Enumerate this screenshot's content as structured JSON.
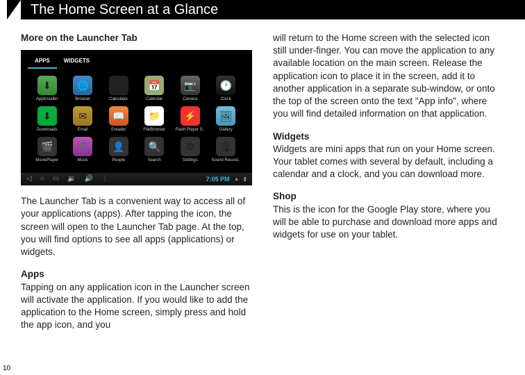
{
  "title": "The Home Screen at a Glance",
  "left": {
    "heading": "More on the Launcher Tab",
    "tabs": {
      "apps": "APPS",
      "widgets": "WIDGETS"
    },
    "apps": [
      {
        "label": "AppInstaller",
        "cls": "ic-install",
        "g": "⬇"
      },
      {
        "label": "Browser",
        "cls": "ic-browser",
        "g": "🌐"
      },
      {
        "label": "Calculator",
        "cls": "ic-calc",
        "g": "🖩"
      },
      {
        "label": "Calendar",
        "cls": "ic-cal",
        "g": "📅"
      },
      {
        "label": "Camera",
        "cls": "ic-cam",
        "g": "📷"
      },
      {
        "label": "Clock",
        "cls": "ic-clock",
        "g": "🕐"
      },
      {
        "label": "Downloads",
        "cls": "ic-down",
        "g": "⬇"
      },
      {
        "label": "Email",
        "cls": "ic-email",
        "g": "✉"
      },
      {
        "label": "Ereader",
        "cls": "ic-ereader",
        "g": "📖"
      },
      {
        "label": "FileBrowser",
        "cls": "ic-file",
        "g": "📁"
      },
      {
        "label": "Flash Player S..",
        "cls": "ic-flash",
        "g": "⚡"
      },
      {
        "label": "Gallery",
        "cls": "ic-gallery",
        "g": "🖼"
      },
      {
        "label": "MoviePlayer",
        "cls": "ic-movie",
        "g": "🎬"
      },
      {
        "label": "Music",
        "cls": "ic-music",
        "g": "🎵"
      },
      {
        "label": "People",
        "cls": "ic-people",
        "g": "👤"
      },
      {
        "label": "Search",
        "cls": "ic-search",
        "g": "🔍"
      },
      {
        "label": "Settings",
        "cls": "ic-settings",
        "g": "⚙"
      },
      {
        "label": "Sound Record..",
        "cls": "ic-sound",
        "g": "🎙"
      }
    ],
    "clock": "7:05 PM",
    "p1": "The Launcher Tab is a convenient way to access all of your applications (apps).  After tapping the icon, the screen will open to the Launcher Tab page.  At the top, you will find options to see all apps (applications) or widgets.",
    "h_apps": "Apps",
    "p2": "Tapping on any application icon in the Launcher screen will activate the application.  If you would like to add the application to the Home screen, simply press and hold the app icon, and you"
  },
  "right": {
    "p1": "will return to the Home screen with the selected icon still under-finger.  You can move the application to any available location on the main screen.  Release the application icon to place it in the screen, add it to another application in a separate sub-window, or onto the top of the screen onto the text \"App info\", where you will find detailed information on that application.",
    "h_widgets": "Widgets",
    "p2": "Widgets are mini apps that run on your Home screen. Your tablet comes with several by default, including a calendar and a clock, and you can download more.",
    "h_shop": "Shop",
    "p3": "This is the icon for the Google Play store, where you will be able to purchase and download more apps and widgets for use on your tablet."
  },
  "page_number": "10"
}
